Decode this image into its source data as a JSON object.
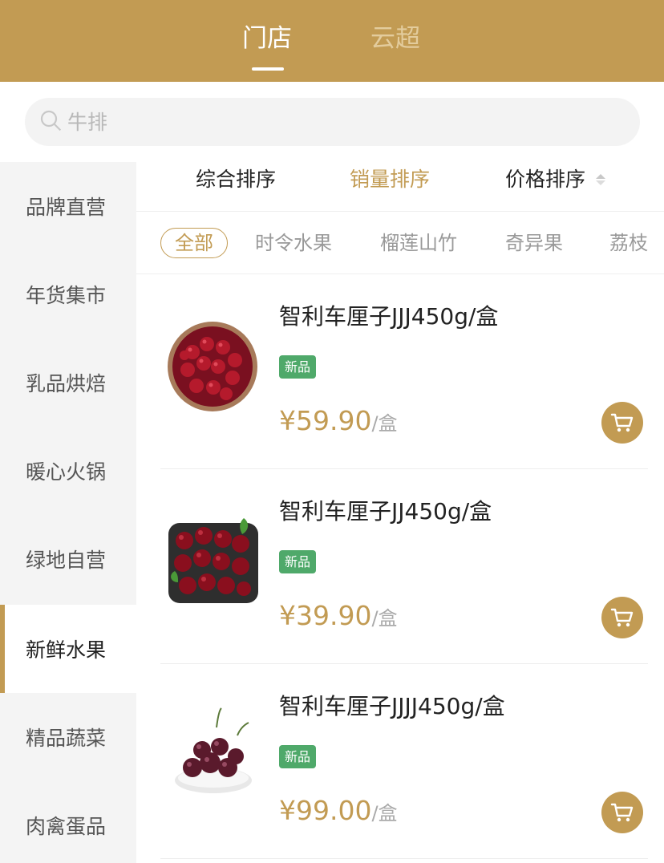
{
  "header": {
    "tabs": [
      {
        "label": "门店",
        "active": true
      },
      {
        "label": "云超",
        "active": false
      }
    ]
  },
  "search": {
    "placeholder": "牛排"
  },
  "sidebar": {
    "items": [
      {
        "label": "品牌直营"
      },
      {
        "label": "年货集市"
      },
      {
        "label": "乳品烘焙"
      },
      {
        "label": "暖心火锅"
      },
      {
        "label": "绿地自营"
      },
      {
        "label": "新鲜水果",
        "active": true
      },
      {
        "label": "精品蔬菜"
      },
      {
        "label": "肉禽蛋品"
      }
    ]
  },
  "sort": {
    "options": [
      {
        "label": "综合排序"
      },
      {
        "label": "销量排序",
        "active": true
      },
      {
        "label": "价格排序"
      }
    ]
  },
  "subcategories": [
    {
      "label": "全部",
      "active": true
    },
    {
      "label": "时令水果"
    },
    {
      "label": "榴莲山竹"
    },
    {
      "label": "奇异果"
    },
    {
      "label": "荔枝"
    }
  ],
  "products": [
    {
      "name": "智利车厘子JJJ450g/盒",
      "badge": "新品",
      "price": "¥59.90",
      "unit": "/盒"
    },
    {
      "name": "智利车厘子JJ450g/盒",
      "badge": "新品",
      "price": "¥39.90",
      "unit": "/盒"
    },
    {
      "name": "智利车厘子JJJJ450g/盒",
      "badge": "新品",
      "price": "¥99.00",
      "unit": "/盒"
    }
  ],
  "colors": {
    "brand": "#c29b53",
    "badge": "#4fa96a"
  },
  "icons": [
    "search-icon",
    "sort-arrows-icon",
    "cart-icon"
  ]
}
